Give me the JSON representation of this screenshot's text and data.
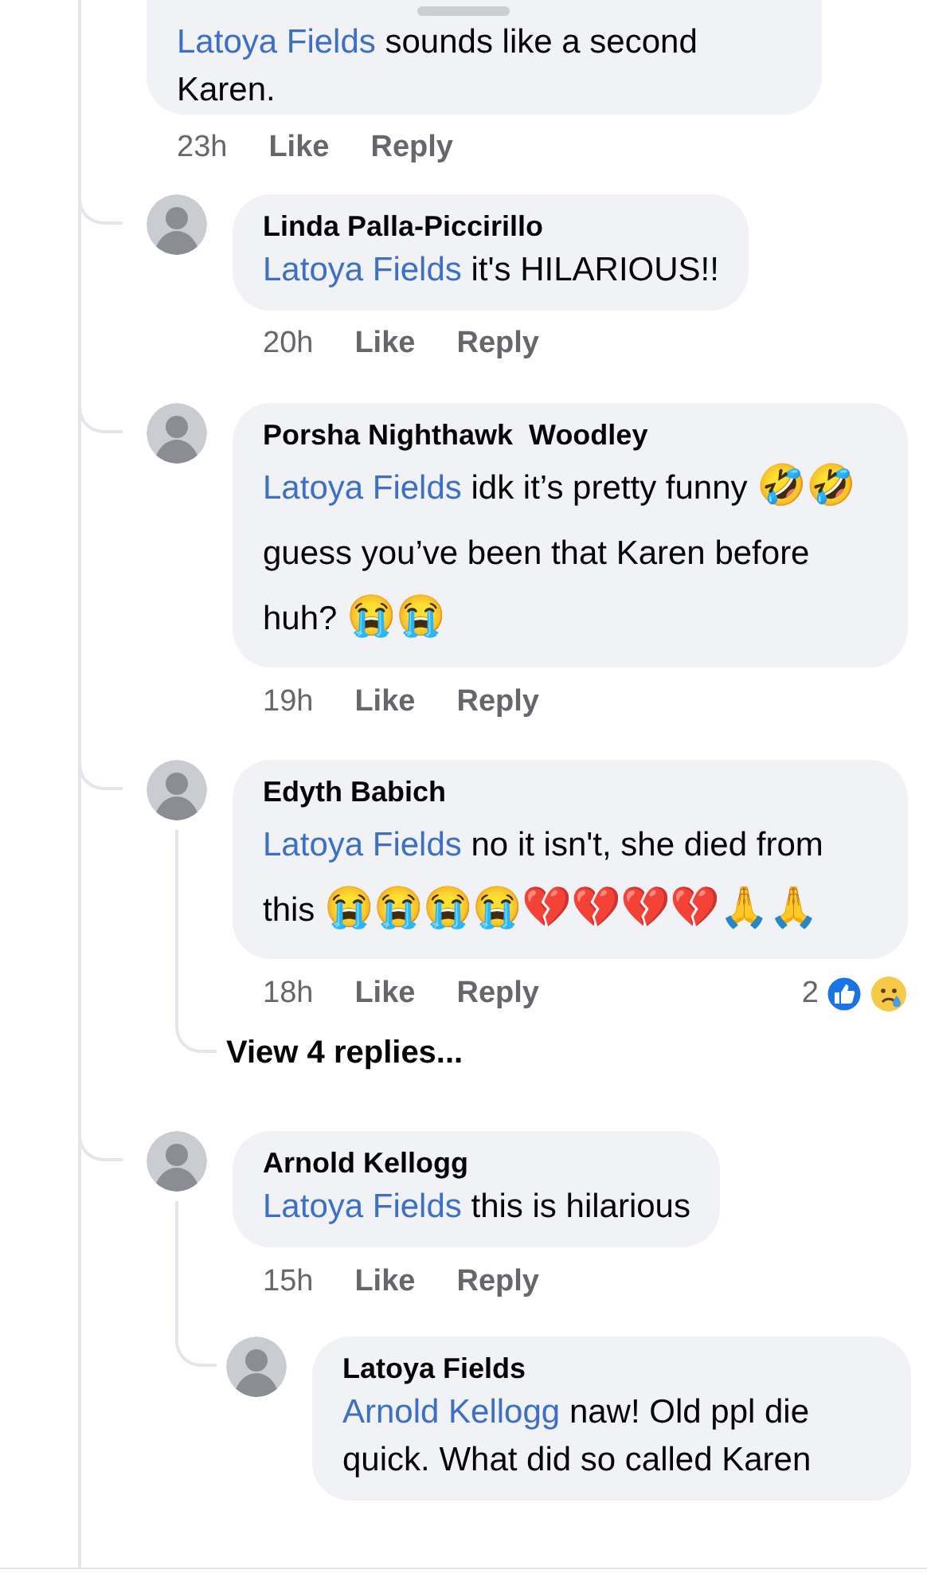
{
  "comments": [
    {
      "mention": "Latoya Fields",
      "text": "sounds like a second Karen.",
      "time": "23h",
      "actions": [
        "Like",
        "Reply"
      ]
    },
    {
      "author": "Linda Palla-Piccirillo",
      "mention": "Latoya Fields",
      "text": "it's HILARIOUS!!",
      "time": "20h",
      "actions": [
        "Like",
        "Reply"
      ]
    },
    {
      "author": "Porsha Nighthawk  Woodley",
      "mention": "Latoya Fields",
      "text": "idk it’s pretty funny 🤣🤣 guess you’ve been that Karen before huh? 😭😭",
      "time": "19h",
      "actions": [
        "Like",
        "Reply"
      ]
    },
    {
      "author": "Edyth Babich",
      "mention": "Latoya Fields",
      "text": "no it isn't, she died from this 😭😭😭😭💔💔💔💔🙏🙏",
      "time": "18h",
      "actions": [
        "Like",
        "Reply"
      ],
      "reactions": {
        "count": "2"
      },
      "replies_link": "View 4 replies..."
    },
    {
      "author": "Arnold Kellogg",
      "mention": "Latoya Fields",
      "text": "this is hilarious",
      "time": "15h",
      "actions": [
        "Like",
        "Reply"
      ],
      "replies": [
        {
          "author": "Latoya Fields",
          "mention": "Arnold Kellogg",
          "text": "naw! Old ppl die quick. What did so called Karen"
        }
      ]
    }
  ]
}
